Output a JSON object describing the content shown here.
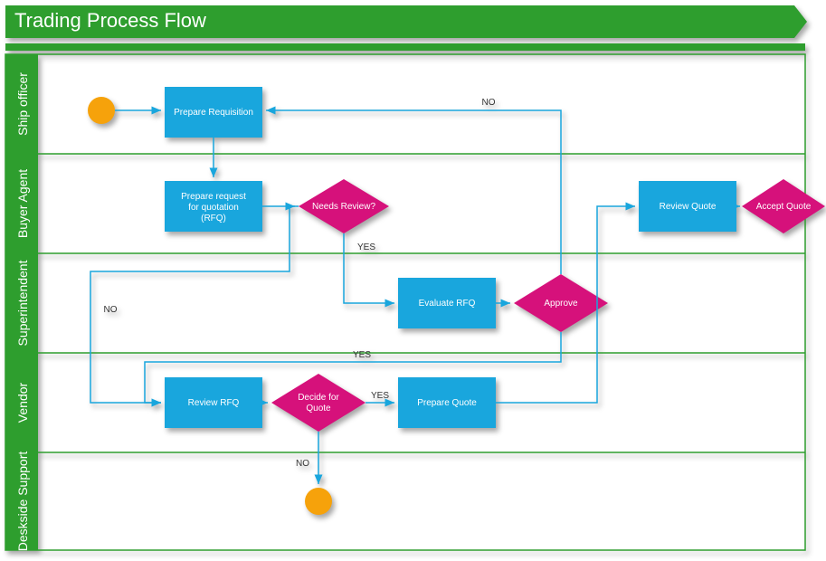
{
  "title": "Trading Process Flow",
  "lanes": [
    {
      "id": "ship",
      "label": "Ship officer"
    },
    {
      "id": "buyer",
      "label": "Buyer Agent"
    },
    {
      "id": "super",
      "label": "Superintendent"
    },
    {
      "id": "vendor",
      "label": "Vendor"
    },
    {
      "id": "desk",
      "label": "Deskside Support"
    }
  ],
  "nodes": {
    "start": {
      "label": ""
    },
    "prep_req": {
      "label": "Prepare Requisition"
    },
    "prep_rfq": {
      "label1": "Prepare request",
      "label2": "for quotation",
      "label3": "(RFQ)"
    },
    "needs_review": {
      "label": "Needs Review?"
    },
    "eval_rfq": {
      "label": "Evaluate RFQ"
    },
    "approve": {
      "label": "Approve"
    },
    "review_rfq": {
      "label": "Review RFQ"
    },
    "decide_quote": {
      "label1": "Decide for",
      "label2": "Quote"
    },
    "prep_quote": {
      "label": "Prepare Quote"
    },
    "review_quote": {
      "label": "Review Quote"
    },
    "accept_quote": {
      "label": "Accept Quote"
    },
    "end": {
      "label": ""
    }
  },
  "edge_labels": {
    "needs_review_yes": "YES",
    "needs_review_no": "NO",
    "approve_yes": "YES",
    "approve_no": "NO",
    "decide_yes": "YES",
    "decide_no": "NO"
  },
  "colors": {
    "lane": "#2e9e2e",
    "process": "#19a6dd",
    "decision": "#d6117b",
    "terminal": "#f6a20b"
  }
}
